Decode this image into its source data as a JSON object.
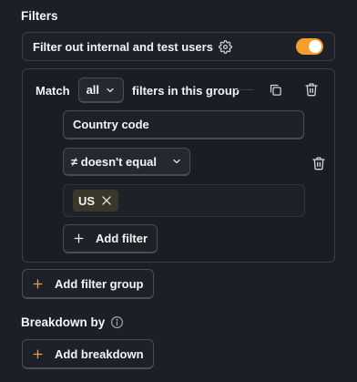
{
  "filters": {
    "title": "Filters",
    "internal_label": "Filter out internal and test users",
    "internal_enabled": true,
    "toggle_color": "#f59e2b",
    "group": {
      "match_prefix": "Match",
      "match_value": "all",
      "match_suffix": "filters in this group",
      "property": "Country code",
      "operator": "≠ doesn't equal",
      "values": [
        "US"
      ],
      "add_filter_label": "Add filter"
    },
    "add_group_label": "Add filter group"
  },
  "breakdown": {
    "title": "Breakdown by",
    "add_label": "Add breakdown"
  },
  "icons": {
    "gear": "gear-icon",
    "copy": "copy-icon",
    "trash": "trash-icon",
    "chevron": "chevron-down-icon",
    "plus": "plus-icon",
    "close": "close-icon",
    "info": "info-icon"
  },
  "accent_color": "#f59e2b"
}
